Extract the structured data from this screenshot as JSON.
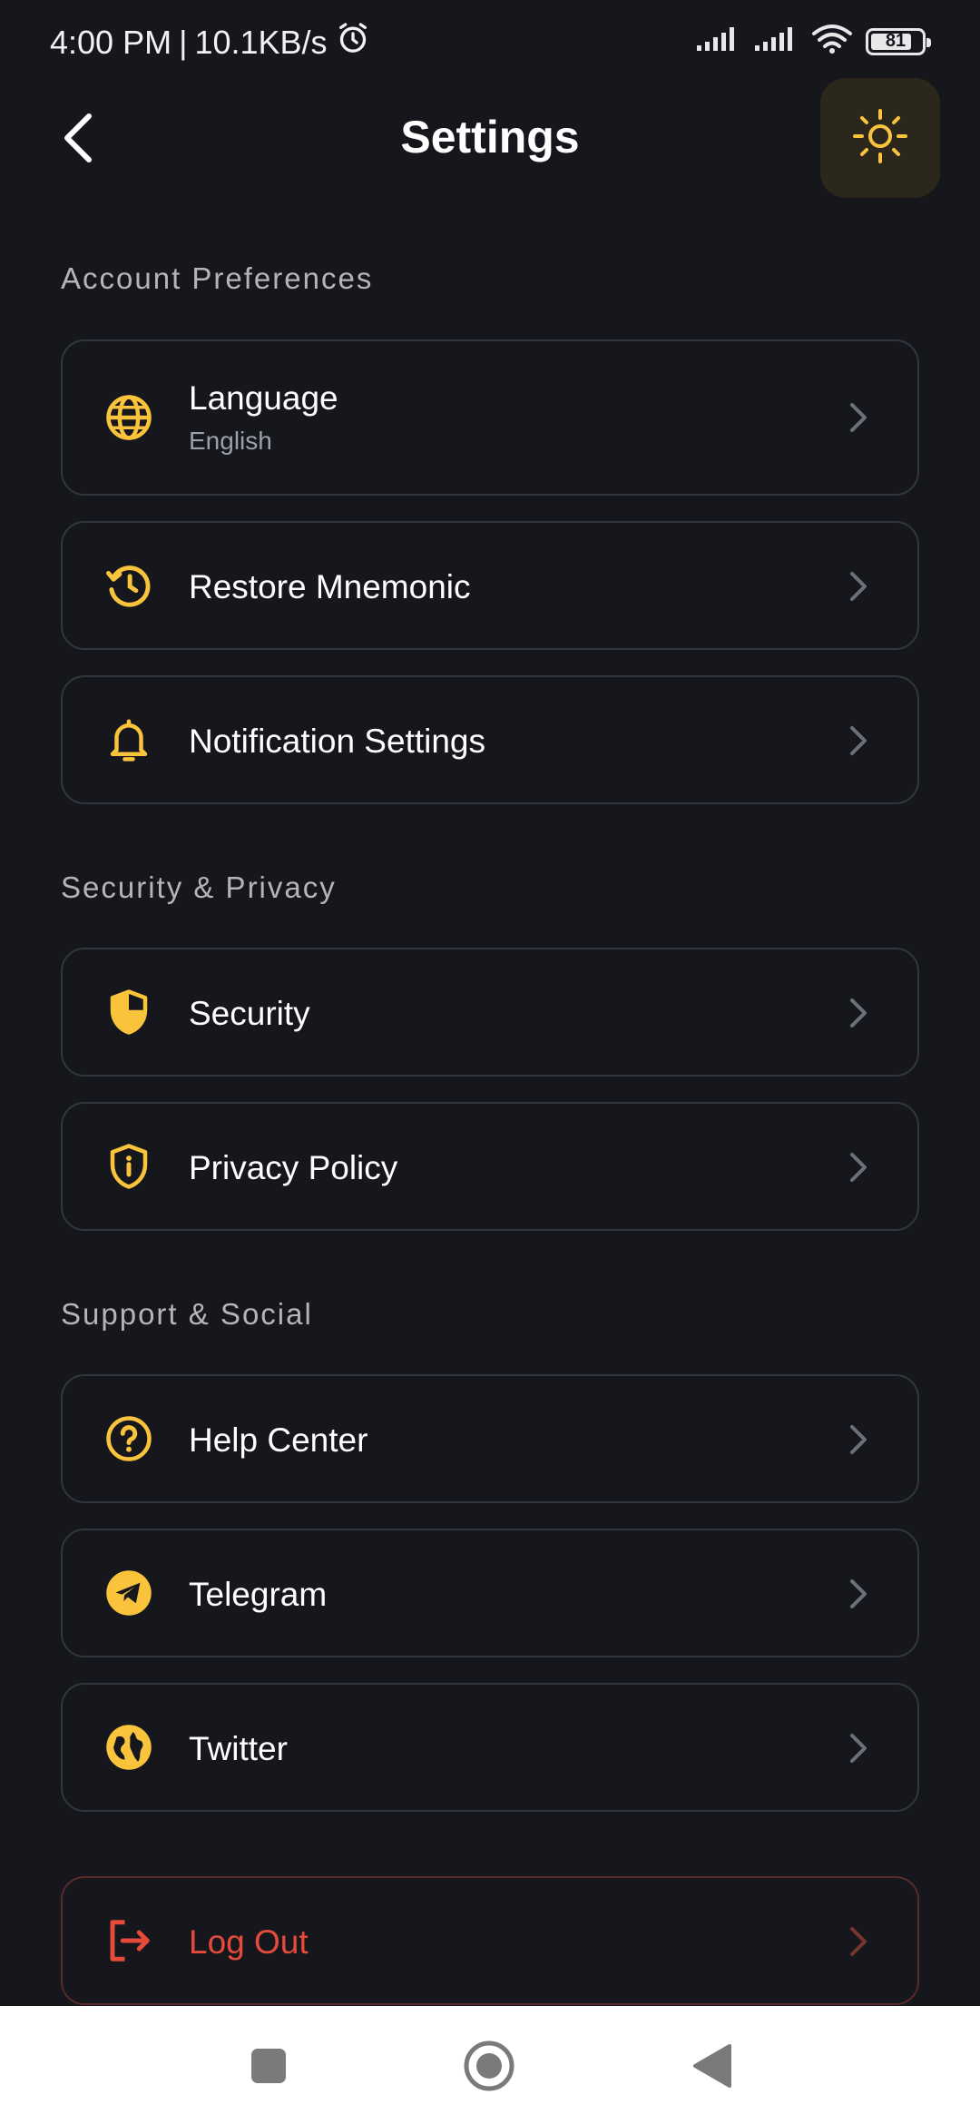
{
  "status_bar": {
    "time": "4:00 PM",
    "separator": "|",
    "speed": "10.1KB/s",
    "battery": "81",
    "battery_level": 0.81
  },
  "header": {
    "title": "Settings"
  },
  "sections": [
    {
      "title": "Account Preferences",
      "items": [
        {
          "label": "Language",
          "sub": "English",
          "icon": "globe-icon"
        },
        {
          "label": "Restore Mnemonic",
          "icon": "history-icon"
        },
        {
          "label": "Notification Settings",
          "icon": "bell-icon"
        }
      ]
    },
    {
      "title": "Security & Privacy",
      "items": [
        {
          "label": "Security",
          "icon": "shield-icon"
        },
        {
          "label": "Privacy Policy",
          "icon": "shield-info-icon"
        }
      ]
    },
    {
      "title": "Support & Social",
      "items": [
        {
          "label": "Help Center",
          "icon": "question-circle-icon"
        },
        {
          "label": "Telegram",
          "icon": "telegram-icon"
        },
        {
          "label": "Twitter",
          "icon": "globe-filled-icon"
        }
      ]
    }
  ],
  "logout": {
    "label": "Log Out",
    "icon": "logout-icon"
  },
  "colors": {
    "background": "#16171c",
    "accent": "#f9c33b",
    "danger": "#e64a3b",
    "card_border": "#34363d"
  }
}
